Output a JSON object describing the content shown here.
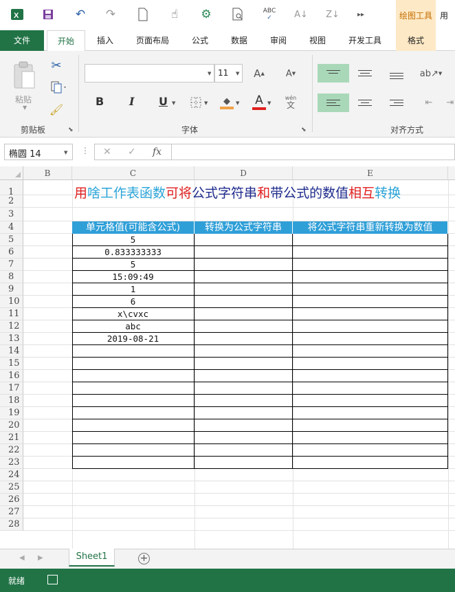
{
  "qat": {
    "context_tab_title": "绘图工具",
    "more_label": "用"
  },
  "tabs": [
    "文件",
    "开始",
    "插入",
    "页面布局",
    "公式",
    "数据",
    "审阅",
    "视图",
    "开发工具",
    "格式"
  ],
  "ribbon": {
    "paste_label": "粘贴",
    "clipboard_label": "剪贴板",
    "font_label": "字体",
    "alignment_label": "对齐方式",
    "font_name": "",
    "font_size": "11",
    "bold": "B",
    "italic": "I",
    "underline": "U",
    "font_color_letter": "A",
    "phonetic_top": "wén",
    "phonetic_bottom": "文"
  },
  "formula_bar": {
    "name_box": "椭圆 14",
    "fx": "fx",
    "cancel": "✕",
    "enter": "✓",
    "formula": ""
  },
  "columns": [
    "B",
    "C",
    "D",
    "E"
  ],
  "rows": [
    "1",
    "2",
    "3",
    "4",
    "5",
    "6",
    "7",
    "8",
    "9",
    "10",
    "11",
    "12",
    "13",
    "14",
    "15",
    "16",
    "17",
    "18",
    "19",
    "20",
    "21",
    "22",
    "23",
    "24",
    "25",
    "26",
    "27",
    "28"
  ],
  "title_segments": [
    {
      "text": "用",
      "color": "#e02020"
    },
    {
      "text": "啥工作表函数",
      "color": "#2aa4d8"
    },
    {
      "text": "可将",
      "color": "#e02020"
    },
    {
      "text": "公式字符串",
      "color": "#1d2a8c"
    },
    {
      "text": "和",
      "color": "#e02020"
    },
    {
      "text": "带公式的数值",
      "color": "#1d2a8c"
    },
    {
      "text": "相互",
      "color": "#e02020"
    },
    {
      "text": "转换",
      "color": "#2aa4d8"
    }
  ],
  "table": {
    "headers": [
      "单元格值(可能含公式)",
      "转换为公式字符串",
      "将公式字符串重新转换为数值"
    ],
    "values": [
      "5",
      "0.833333333",
      "5",
      "15:09:49",
      "1",
      "6",
      "x\\cvxc",
      "abc",
      "2019-08-21",
      "",
      "",
      "",
      "",
      "",
      "",
      "",
      "",
      "",
      ""
    ]
  },
  "sheet_tab": "Sheet1",
  "status": {
    "ready": "就绪"
  }
}
